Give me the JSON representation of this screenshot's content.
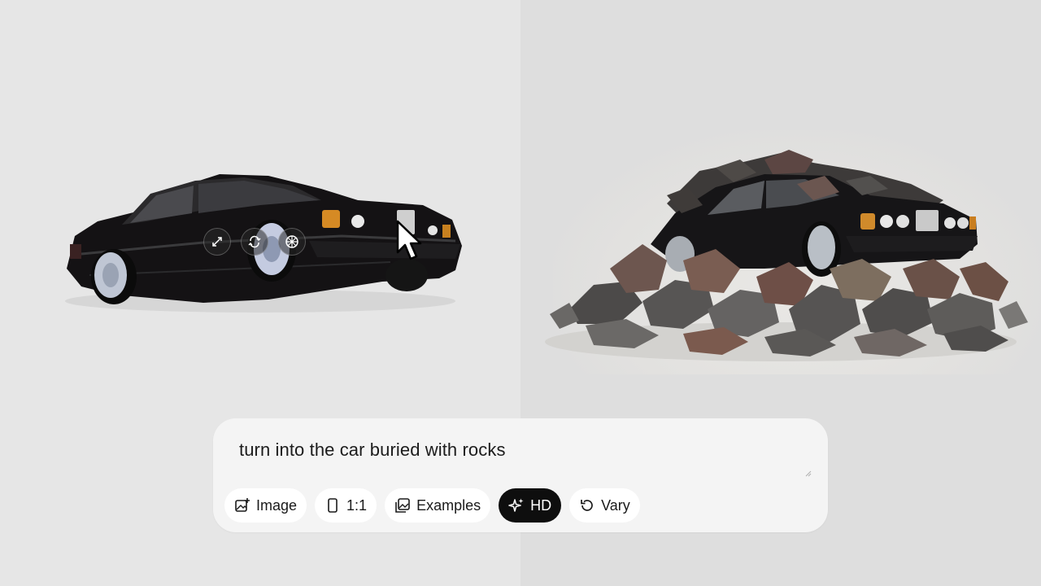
{
  "source_panel": {
    "tools": [
      {
        "icon": "expand-icon"
      },
      {
        "icon": "rotate-icon"
      },
      {
        "icon": "wheel-icon"
      }
    ]
  },
  "composer": {
    "prompt": "turn into the car buried with rocks",
    "chips": [
      {
        "label": "Image",
        "icon": "image-add-icon",
        "active": false
      },
      {
        "label": "1:1",
        "icon": "phone-aspect-icon",
        "active": false
      },
      {
        "label": "Examples",
        "icon": "gallery-icon",
        "active": false
      },
      {
        "label": "HD",
        "icon": "sparkle-icon",
        "active": true
      },
      {
        "label": "Vary",
        "icon": "refresh-icon",
        "active": false
      }
    ]
  },
  "colors": {
    "left_bg": "#e6e6e6",
    "right_bg": "#dedede",
    "active_chip": "#0e0e0e"
  }
}
